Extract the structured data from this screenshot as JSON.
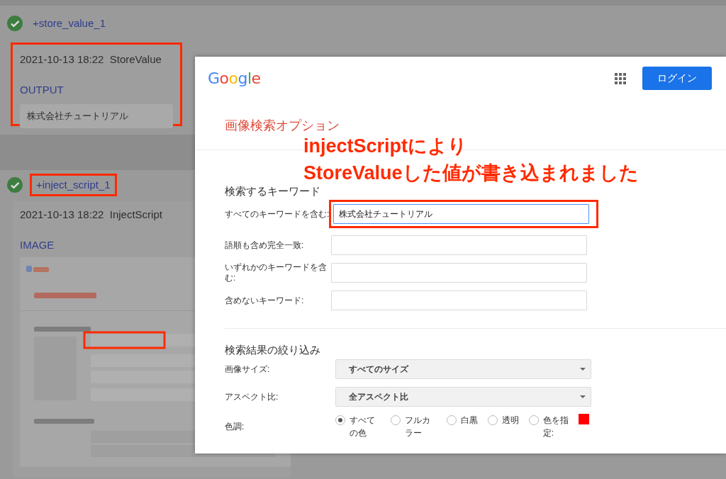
{
  "steps": [
    {
      "title": "+store_value_1",
      "passed": true,
      "title_highlighted": false,
      "card_highlighted": true,
      "timestamp": "2021-10-13 18:22",
      "action": "StoreValue",
      "section_label": "OUTPUT",
      "output": "株式会社チュートリアル"
    },
    {
      "title": "+inject_script_1",
      "passed": true,
      "title_highlighted": true,
      "card_highlighted": false,
      "timestamp": "2021-10-13 18:22",
      "action": "InjectScript",
      "section_label": "IMAGE"
    }
  ],
  "browser_page": {
    "logo": "Google",
    "login": "ログイン",
    "heading": "画像検索オプション",
    "sections": [
      {
        "title": "検索するキーワード",
        "rows": [
          {
            "kind": "text",
            "label": "すべてのキーワードを含む:",
            "value": "株式会社チュートリアル",
            "focused": true,
            "highlighted": true
          },
          {
            "kind": "text",
            "label": "語順も含め完全一致:",
            "focused": false,
            "highlighted": false
          },
          {
            "kind": "text",
            "label": "いずれかのキーワードを含む:",
            "focused": false,
            "highlighted": false
          },
          {
            "kind": "text",
            "label": "含めないキーワード:",
            "focused": false,
            "highlighted": false
          }
        ]
      },
      {
        "title": "検索結果の絞り込み",
        "rows": [
          {
            "kind": "select",
            "label": "画像サイズ:",
            "value": "すべてのサイズ"
          },
          {
            "kind": "select",
            "label": "アスペクト比:",
            "value": "全アスペクト比"
          },
          {
            "kind": "radio",
            "label": "色調:",
            "options": [
              {
                "label": "すべての色",
                "selected": true
              },
              {
                "label": "フルカラー",
                "selected": false
              },
              {
                "label": "白黒",
                "selected": false
              },
              {
                "label": "透明",
                "selected": false
              },
              {
                "label": "色を指定:",
                "selected": false,
                "color": "#ff0000"
              }
            ]
          }
        ]
      }
    ]
  },
  "annotation": {
    "lines": [
      "injectScriptにより",
      "StoreValueした値が書き込まれました"
    ]
  }
}
